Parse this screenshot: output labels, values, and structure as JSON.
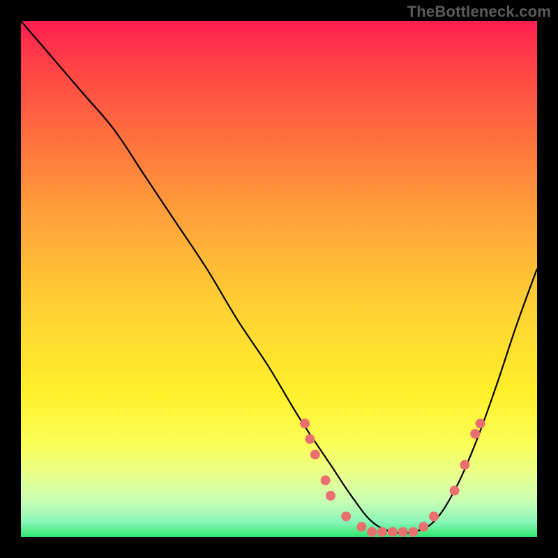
{
  "watermark": "TheBottleneck.com",
  "chart_data": {
    "type": "line",
    "title": "",
    "xlabel": "",
    "ylabel": "",
    "xlim": [
      0,
      100
    ],
    "ylim": [
      0,
      100
    ],
    "note": "No axes or ticks visible in the image. Values below are estimates of curve height (0=bottom/green, 100=top/red) vs horizontal position (0=left, 100=right).",
    "series": [
      {
        "name": "curve",
        "x": [
          0,
          6,
          12,
          18,
          24,
          30,
          36,
          42,
          48,
          54,
          60,
          64,
          68,
          72,
          76,
          80,
          84,
          88,
          92,
          96,
          100
        ],
        "values": [
          100,
          93,
          86,
          79,
          70,
          61,
          52,
          42,
          33,
          23,
          14,
          8,
          3,
          1,
          1,
          3,
          9,
          18,
          29,
          41,
          52
        ]
      }
    ],
    "markers": {
      "name": "dots",
      "color": "#e96f6f",
      "points": [
        {
          "x": 55,
          "y": 22
        },
        {
          "x": 56,
          "y": 19
        },
        {
          "x": 57,
          "y": 16
        },
        {
          "x": 59,
          "y": 11
        },
        {
          "x": 60,
          "y": 8
        },
        {
          "x": 63,
          "y": 4
        },
        {
          "x": 66,
          "y": 2
        },
        {
          "x": 68,
          "y": 1
        },
        {
          "x": 70,
          "y": 1
        },
        {
          "x": 72,
          "y": 1
        },
        {
          "x": 74,
          "y": 1
        },
        {
          "x": 76,
          "y": 1
        },
        {
          "x": 78,
          "y": 2
        },
        {
          "x": 80,
          "y": 4
        },
        {
          "x": 84,
          "y": 9
        },
        {
          "x": 86,
          "y": 14
        },
        {
          "x": 88,
          "y": 20
        },
        {
          "x": 89,
          "y": 22
        }
      ]
    },
    "gradient_stops": [
      {
        "pos": 0,
        "color": "#ff1e52"
      },
      {
        "pos": 22,
        "color": "#ff6e3e"
      },
      {
        "pos": 55,
        "color": "#ffd033"
      },
      {
        "pos": 82,
        "color": "#fbff57"
      },
      {
        "pos": 97,
        "color": "#8cf7b8"
      },
      {
        "pos": 100,
        "color": "#2ee56e"
      }
    ]
  }
}
